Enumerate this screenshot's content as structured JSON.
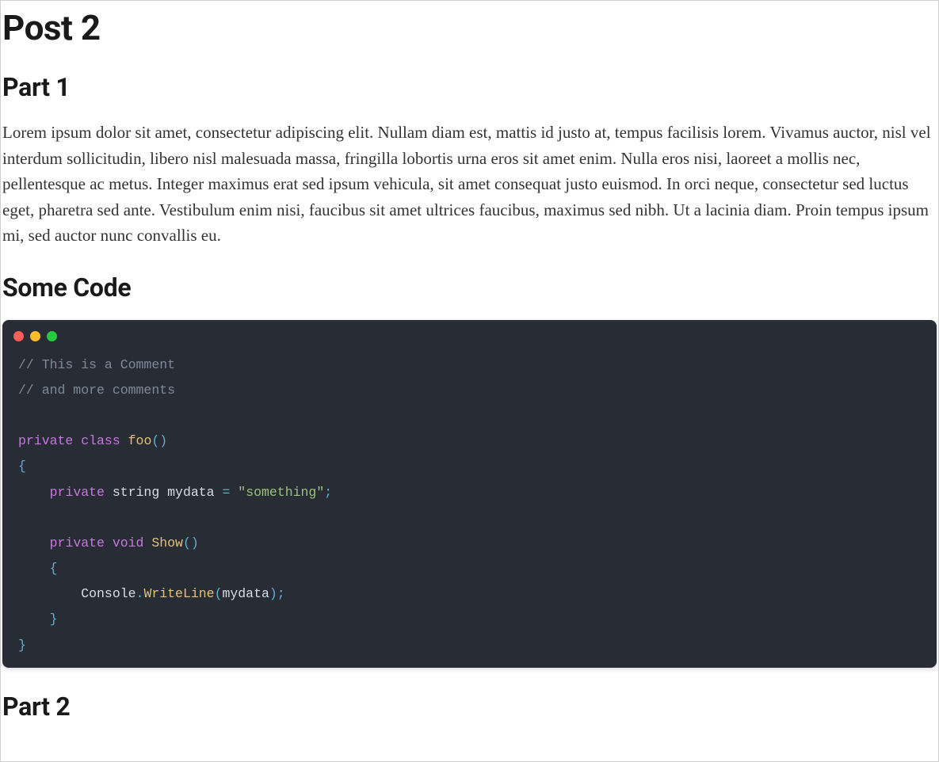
{
  "post": {
    "title": "Post 2",
    "sections": {
      "part1": {
        "heading": "Part 1",
        "paragraph": "Lorem ipsum dolor sit amet, consectetur adipiscing elit. Nullam diam est, mattis id justo at, tempus facilisis lorem. Vivamus auctor, nisl vel interdum sollicitudin, libero nisl malesuada massa, fringilla lobortis urna eros sit amet enim. Nulla eros nisi, laoreet a mollis nec, pellentesque ac metus. Integer maximus erat sed ipsum vehicula, sit amet consequat justo euismod. In orci neque, consectetur sed luctus eget, pharetra sed ante. Vestibulum enim nisi, faucibus sit amet ultrices faucibus, maximus sed nibh. Ut a lacinia diam. Proin tempus ipsum mi, sed auctor nunc convallis eu."
      },
      "code": {
        "heading": "Some Code",
        "tokens": {
          "c1": "// This is a Comment",
          "c2": "// and more comments",
          "kw_private1": "private",
          "kw_class": "class",
          "cls_foo": "foo",
          "paren_open": "(",
          "paren_close": ")",
          "brace_open": "{",
          "brace_close": "}",
          "kw_private2": "private",
          "type_string": "string",
          "ident_mydata": "mydata",
          "op_eq": "=",
          "str_something": "\"something\"",
          "semi": ";",
          "kw_private3": "private",
          "kw_void": "void",
          "fn_show": "Show",
          "console": "Console",
          "dot": ".",
          "writeline": "WriteLine",
          "ident_mydata2": "mydata"
        }
      },
      "part2": {
        "heading": "Part 2"
      }
    }
  }
}
